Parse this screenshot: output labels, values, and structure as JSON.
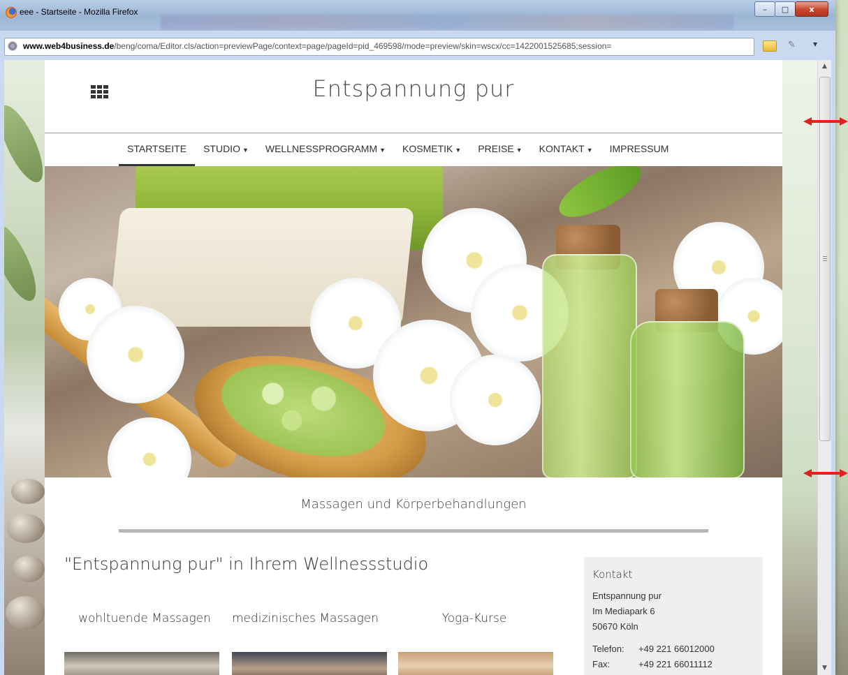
{
  "window": {
    "title": "eee - Startseite - Mozilla Firefox",
    "controls": {
      "minimize": "–",
      "maximize": "□",
      "close": "x"
    }
  },
  "browser": {
    "url_domain": "www.web4business.de",
    "url_path": "/beng/coma/Editor.cls/action=previewPage/context=page/pageId=pid_469598/mode=preview/skin=wscx/cc=1422001525685;session="
  },
  "site": {
    "title": "Entspannung pur",
    "menu": [
      {
        "label": "STARTSEITE",
        "active": true,
        "dropdown": false
      },
      {
        "label": "STUDIO",
        "active": false,
        "dropdown": true
      },
      {
        "label": "WELLNESSPROGRAMM",
        "active": false,
        "dropdown": true
      },
      {
        "label": "KOSMETIK",
        "active": false,
        "dropdown": true
      },
      {
        "label": "PREISE",
        "active": false,
        "dropdown": true
      },
      {
        "label": "KONTAKT",
        "active": false,
        "dropdown": true
      },
      {
        "label": "IMPRESSUM",
        "active": false,
        "dropdown": false
      }
    ],
    "subtitle": "Massagen und Körperbehandlungen",
    "heading": "\"Entspannung pur\" in Ihrem Wellnessstudio",
    "cards": [
      {
        "title": "wohltuende Massagen"
      },
      {
        "title": "medizinisches Massagen"
      },
      {
        "title": "Yoga-Kurse"
      }
    ],
    "contact": {
      "title": "Kontakt",
      "name": "Entspannung pur",
      "street": "Im Mediapark 6",
      "city": "50670 Köln",
      "phone_label": "Telefon:",
      "phone": "+49 221 66012000",
      "fax_label": "Fax:",
      "fax": "+49 221 66011112"
    }
  },
  "colors": {
    "accent_arrow": "#e0231c",
    "text": "#333333",
    "divider": "#b3b8ba"
  }
}
